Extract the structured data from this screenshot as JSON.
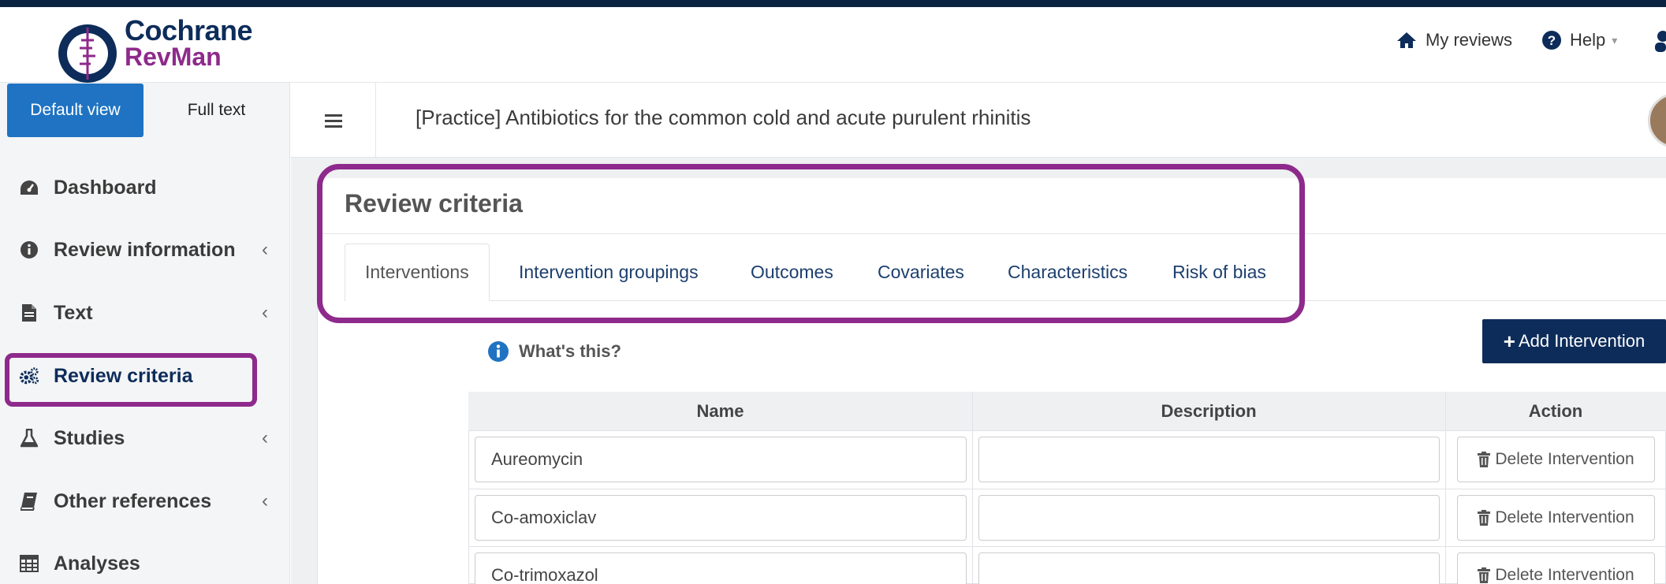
{
  "app": {
    "brand_line1": "Cochrane",
    "brand_line2": "RevMan",
    "accent_color": "#8e2a8b",
    "navy_color": "#0d2c5a"
  },
  "header_nav": {
    "my_reviews": "My reviews",
    "help": "Help"
  },
  "view_tabs": {
    "default_view": "Default view",
    "full_text": "Full text"
  },
  "sidebar": {
    "items": [
      {
        "label": "Dashboard",
        "icon": "dashboard-icon"
      },
      {
        "label": "Review information",
        "icon": "info-icon"
      },
      {
        "label": "Text",
        "icon": "document-icon"
      },
      {
        "label": "Review criteria",
        "icon": "gears-icon"
      },
      {
        "label": "Studies",
        "icon": "flask-icon"
      },
      {
        "label": "Other references",
        "icon": "book-icon"
      },
      {
        "label": "Analyses",
        "icon": "table-icon"
      }
    ]
  },
  "review": {
    "title": "[Practice] Antibiotics for the common cold and acute purulent rhinitis"
  },
  "panel": {
    "title": "Review criteria",
    "tabs": [
      "Interventions",
      "Intervention groupings",
      "Outcomes",
      "Covariates",
      "Characteristics",
      "Risk of bias"
    ],
    "active_tab": "Interventions",
    "whats_this": "What's this?",
    "add_button": "Add Intervention"
  },
  "table": {
    "headers": [
      "Name",
      "Description",
      "Action"
    ],
    "rows": [
      {
        "name": "Aureomycin",
        "description": "",
        "action": "Delete Intervention"
      },
      {
        "name": "Co-amoxiclav",
        "description": "",
        "action": "Delete Intervention"
      },
      {
        "name": "Co-trimoxazol",
        "description": "",
        "action": "Delete Intervention"
      }
    ]
  }
}
